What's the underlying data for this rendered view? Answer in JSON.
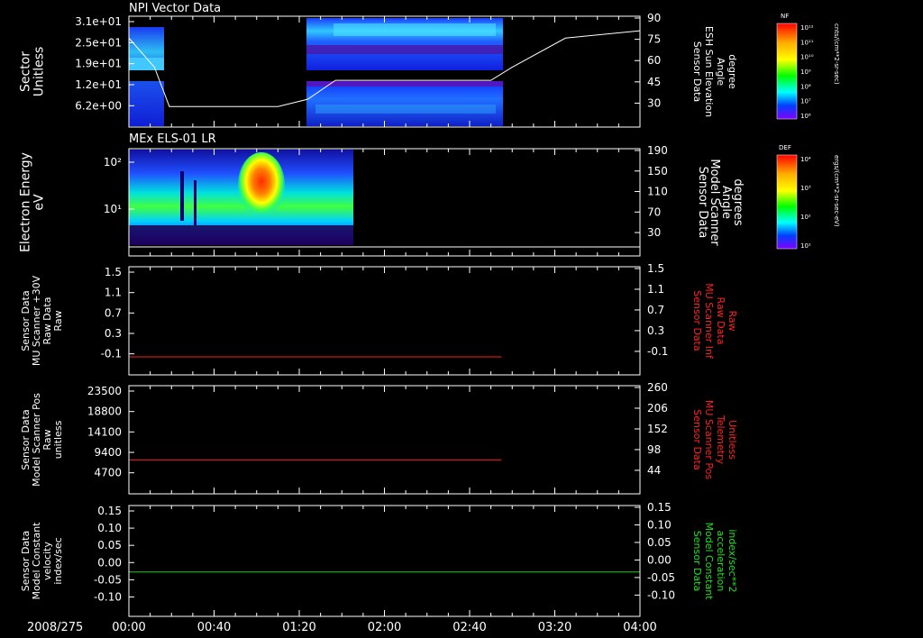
{
  "time_axis": {
    "date_label": "2008/275",
    "ticks": [
      "00:00",
      "00:40",
      "01:20",
      "02:00",
      "02:40",
      "03:20",
      "04:00"
    ]
  },
  "colors": {
    "background": "#000000",
    "axis": "#ffffff",
    "red_trace": "#ff2020",
    "green_trace": "#20d020",
    "red_label": "#ff2020",
    "green_label": "#20e020"
  },
  "chart_data": [
    {
      "type": "heatmap",
      "title": "NPI Vector Data",
      "ylabel_left": [
        "Sector",
        "Unitless"
      ],
      "yticks_left": [
        "3.1e+01",
        "2.5e+01",
        "1.9e+01",
        "1.2e+01",
        "6.2e+00"
      ],
      "ylabel_right": [
        "Sensor Data",
        "ESH Sun Elevation",
        "Angle",
        "degree"
      ],
      "yticks_right": [
        "90",
        "75",
        "60",
        "45",
        "30"
      ],
      "colorbar": {
        "label": "NF",
        "units": "cnts/(cm**2-sr-sec)",
        "ticks": [
          "10¹²",
          "10¹¹",
          "10¹⁰",
          "10⁹",
          "10⁸",
          "10⁷",
          "10⁶"
        ]
      },
      "overlay_line": {
        "name": "ESH Sun Elevation Angle",
        "x": [
          "00:00",
          "00:12",
          "00:19",
          "01:10",
          "01:24",
          "01:37",
          "02:50",
          "03:00",
          "03:25",
          "04:00"
        ],
        "y": [
          75,
          55,
          28,
          28,
          33,
          46,
          46,
          55,
          75,
          80
        ]
      }
    },
    {
      "type": "heatmap",
      "title": "MEx ELS-01 LR",
      "ylabel_left": [
        "Electron Energy",
        "eV"
      ],
      "yticks_left": [
        "10²",
        "10¹"
      ],
      "ylabel_right": [
        "Sensor Data",
        "Model Scanner",
        "Angle",
        "degrees"
      ],
      "yticks_right": [
        "190",
        "150",
        "110",
        "70",
        "30"
      ],
      "colorbar": {
        "label": "DEF",
        "units": "ergs/(cm**2-sr-sec-eV)",
        "ticks": [
          "10⁴",
          "10³",
          "10²",
          "10¹"
        ]
      },
      "overlay_line": {
        "name": "Model Scanner Angle",
        "x": [
          "00:00",
          "04:00"
        ],
        "y": [
          2,
          2
        ]
      }
    },
    {
      "type": "line",
      "ylabel_left": [
        "Sensor Data",
        "MU Scanner +30V",
        "Raw Data",
        "Raw"
      ],
      "yticks_left": [
        "1.5",
        "1.1",
        "0.7",
        "0.3",
        "-0.1"
      ],
      "ylabel_right": [
        "Sensor Data",
        "MU Scanner Inf",
        "Raw Data",
        "Raw"
      ],
      "yticks_right": [
        "1.5",
        "1.1",
        "0.7",
        "0.3",
        "-0.1"
      ],
      "ylim": [
        -0.3,
        1.5
      ],
      "series": [
        {
          "x": [
            "00:00",
            "02:55"
          ],
          "y": [
            0,
            0
          ],
          "color": "#ff2020"
        }
      ]
    },
    {
      "type": "line",
      "ylabel_left": [
        "Sensor Data",
        "Model Scanner Pos",
        "Raw",
        "unitless"
      ],
      "yticks_left": [
        "23500",
        "18800",
        "14100",
        "9400",
        "4700"
      ],
      "ylabel_right": [
        "Sensor Data",
        "MU Scanner Pos",
        "Telemetry",
        "Unitless"
      ],
      "yticks_right": [
        "260",
        "206",
        "152",
        "98",
        "44"
      ],
      "ylim": [
        0,
        23500
      ],
      "series": [
        {
          "x": [
            "00:00",
            "02:55"
          ],
          "y": [
            7400,
            7400
          ],
          "color": "#ff2020"
        }
      ]
    },
    {
      "type": "line",
      "ylabel_left": [
        "Sensor Data",
        "Model Constant",
        "velocity",
        "index/sec"
      ],
      "yticks_left": [
        "0.15",
        "0.10",
        "0.05",
        "0.00",
        "-0.05",
        "-0.10"
      ],
      "ylabel_right": [
        "Sensor Data",
        "Model Constant",
        "acceleration",
        "index/sec**2"
      ],
      "yticks_right": [
        "0.15",
        "0.10",
        "0.05",
        "0.00",
        "-0.05",
        "-0.10"
      ],
      "ylim": [
        -0.1,
        0.15
      ],
      "series": [
        {
          "x": [
            "00:00",
            "04:00"
          ],
          "y": [
            0,
            0
          ],
          "color": "#20d020"
        }
      ]
    }
  ]
}
